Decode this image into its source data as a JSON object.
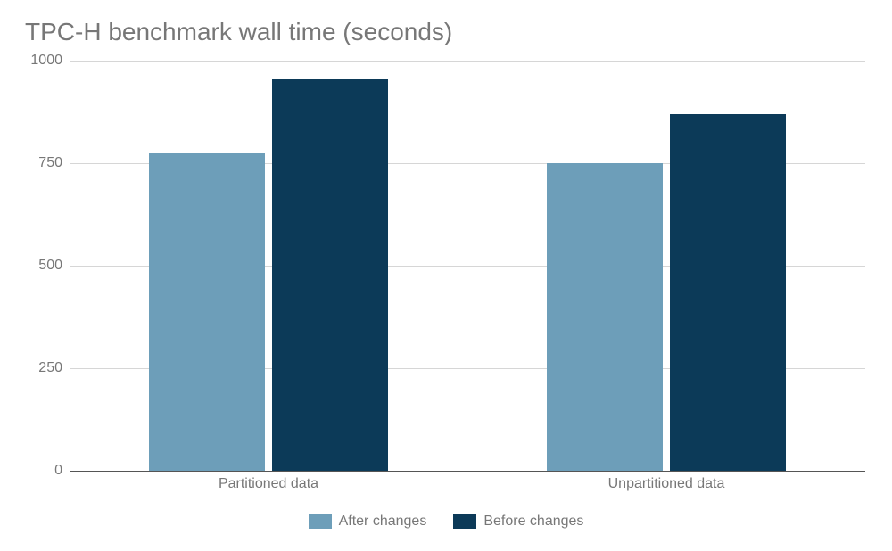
{
  "chart_data": {
    "type": "bar",
    "title": "TPC-H benchmark wall time (seconds)",
    "categories": [
      "Partitioned data",
      "Unpartitioned data"
    ],
    "series": [
      {
        "name": "After changes",
        "values": [
          775,
          750
        ],
        "color": "#6d9eb9"
      },
      {
        "name": "Before changes",
        "values": [
          955,
          870
        ],
        "color": "#0c3a58"
      }
    ],
    "xlabel": "",
    "ylabel": "",
    "ylim": [
      0,
      1000
    ],
    "yticks": [
      0,
      250,
      500,
      750,
      1000
    ],
    "legend_position": "bottom",
    "grid": "horizontal"
  }
}
